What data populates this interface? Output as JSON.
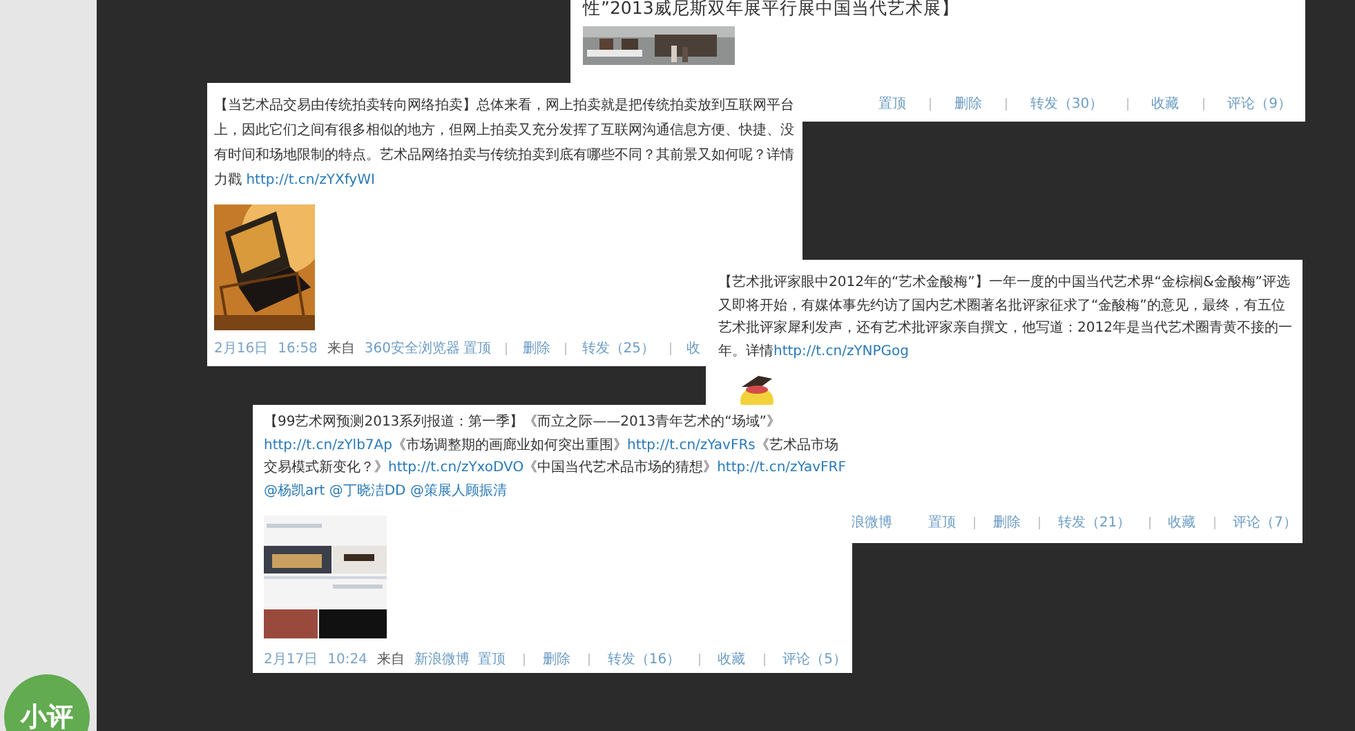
{
  "side_badge": {
    "label": "小评"
  },
  "posts": [
    {
      "segments": [
        {
          "text": "性”2013威尼斯双年展平行展中国当代艺术展】"
        }
      ],
      "footer": {
        "actions": [
          "置顶",
          "删除",
          "转发（30）",
          "收藏",
          "评论（9）"
        ]
      }
    },
    {
      "segments": [
        {
          "text": "【当艺术品交易由传统拍卖转向网络拍卖】总体来看，网上拍卖就是把传统拍卖放到互联网平台上，因此它们之间有很多相似的地方，但网上拍卖又充分发挥了互联网沟通信息方便、快捷、没有时间和场地限制的特点。艺术品网络拍卖与传统拍卖到底有哪些不同？其前景又如何呢？详情力戳 "
        },
        {
          "link": "http://t.cn/zYXfyWI"
        }
      ],
      "footer": {
        "date": "2月16日",
        "time": "16:58",
        "via": "来自",
        "source": "360安全浏览器",
        "actions": [
          "置顶",
          "删除",
          "转发（25）",
          "收"
        ]
      }
    },
    {
      "segments": [
        {
          "text": "【艺术批评家眼中2012年的“艺术金酸梅”】一年一度的中国当代艺术界“金棕榈&金酸梅”评选又即将开始，有媒体事先约访了国内艺术圈著名批评家征求了“金酸梅”的意见，最终，有五位艺术批评家犀利发声，还有艺术批评家亲自撰文，他写道：2012年是当代艺术圈青黄不接的一年。详情"
        },
        {
          "link": "http://t.cn/zYNPGog"
        }
      ],
      "footer": {
        "source": "浪微博",
        "actions": [
          "置顶",
          "删除",
          "转发（21）",
          "收藏",
          "评论（7）"
        ]
      }
    },
    {
      "segments": [
        {
          "text": "【99艺术网预测2013系列报道：第一季】《而立之际——2013青年艺术的“场域”》"
        },
        {
          "link": "http://t.cn/zYlb7Ap"
        },
        {
          "text": "《市场调整期的画廊业如何突出重围》"
        },
        {
          "link": "http://t.cn/zYavFRs"
        },
        {
          "text": "《艺术品市场交易模式新变化？》"
        },
        {
          "link": "http://t.cn/zYxoDVO"
        },
        {
          "text": "《中国当代艺术品市场的猜想》"
        },
        {
          "link": "http://t.cn/zYavFRF"
        },
        {
          "link": "@杨凯art"
        },
        {
          "link": "@丁晓洁DD"
        },
        {
          "link": "@策展人顾振清"
        }
      ],
      "footer": {
        "date": "2月17日",
        "time": "10:24",
        "via": "来自",
        "source": "新浪微博",
        "actions": [
          "置顶",
          "删除",
          "转发（16）",
          "收藏",
          "评论（5）"
        ]
      }
    }
  ]
}
